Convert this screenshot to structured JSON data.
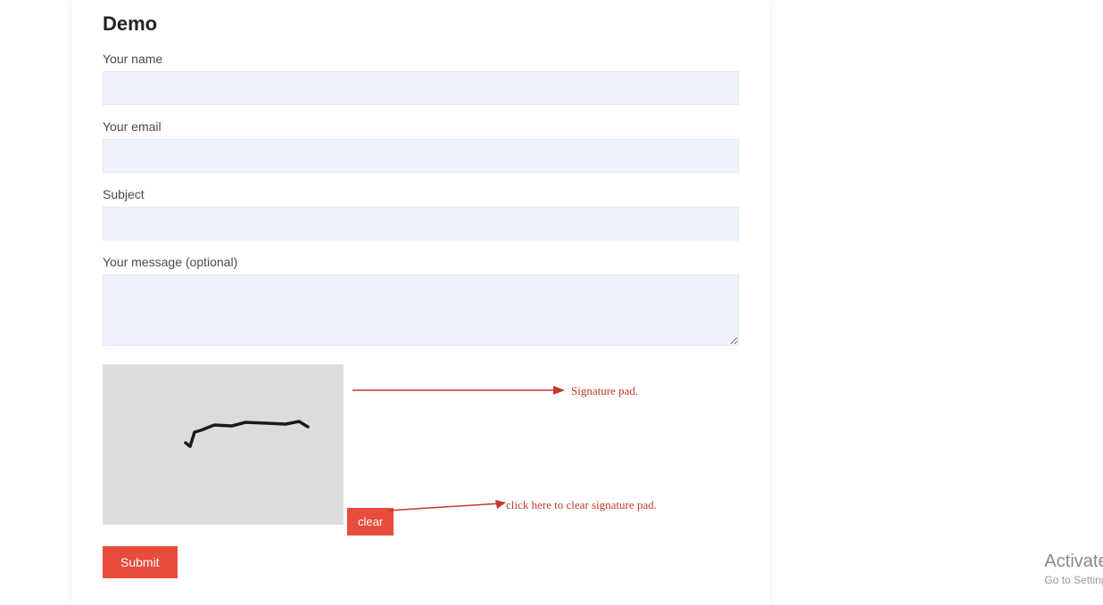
{
  "page": {
    "title": "Demo"
  },
  "form": {
    "name": {
      "label": "Your name",
      "value": ""
    },
    "email": {
      "label": "Your email",
      "value": ""
    },
    "subject": {
      "label": "Subject",
      "value": ""
    },
    "message": {
      "label": "Your message (optional)",
      "value": ""
    },
    "clear_label": "clear",
    "submit_label": "Submit"
  },
  "annotations": {
    "signature_pad": "Signature pad.",
    "clear_hint": "click here to clear signature pad."
  },
  "watermark": {
    "title": "Activate W",
    "subtitle": "Go to Setting"
  }
}
